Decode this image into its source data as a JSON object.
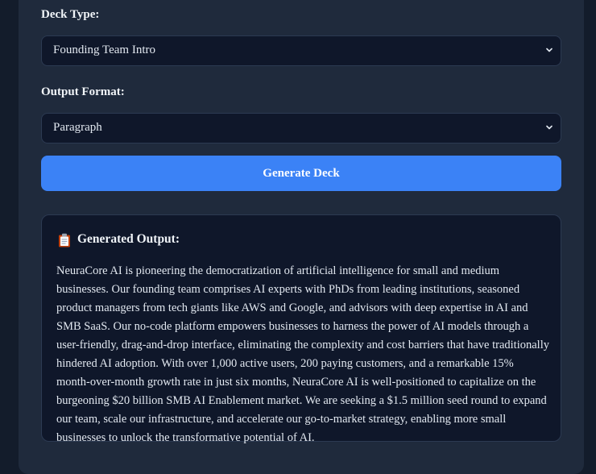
{
  "form": {
    "deck_type_label": "Deck Type:",
    "deck_type_value": "Founding Team Intro",
    "output_format_label": "Output Format:",
    "output_format_value": "Paragraph",
    "generate_button": "Generate Deck"
  },
  "output": {
    "icon": "clipboard-icon",
    "title": "Generated Output:",
    "text": "NeuraCore AI is pioneering the democratization of artificial intelligence for small and medium businesses. Our founding team comprises AI experts with PhDs from leading institutions, seasoned product managers from tech giants like AWS and Google, and advisors with deep expertise in AI and SMB SaaS. Our no-code platform empowers businesses to harness the power of AI models through a user-friendly, drag-and-drop interface, eliminating the complexity and cost barriers that have traditionally hindered AI adoption. With over 1,000 active users, 200 paying customers, and a remarkable 15% month-over-month growth rate in just six months, NeuraCore AI is well-positioned to capitalize on the burgeoning $20 billion SMB AI Enablement market. We are seeking a $1.5 million seed round to expand our team, scale our infrastructure, and accelerate our go-to-market strategy, enabling more small businesses to unlock the transformative potential of AI."
  },
  "colors": {
    "background": "#131c2b",
    "panel": "#1f2a3c",
    "field": "#0f172a",
    "accent": "#3b82f6"
  }
}
